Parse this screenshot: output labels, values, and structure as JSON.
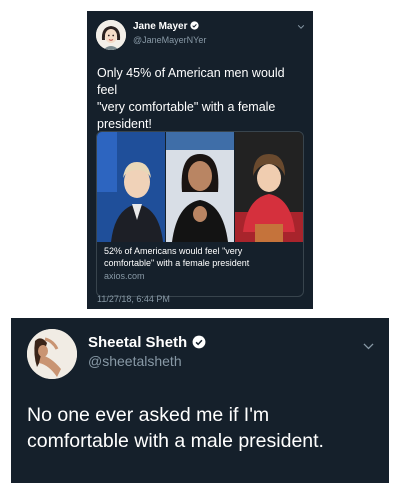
{
  "tweet1": {
    "display_name": "Jane Mayer",
    "handle": "@JaneMayerNYer",
    "text": "Only 45% of American men would feel\n\"very comfortable\" with a female\npresident!",
    "card": {
      "title": "52% of Americans would feel \"very\ncomfortable\" with a female president",
      "domain": "axios.com"
    },
    "timestamp": "11/27/18, 6:44 PM"
  },
  "tweet2": {
    "display_name": "Sheetal Sheth",
    "handle": "@sheetalsheth",
    "text": "No one ever asked me if I'm\ncomfortable with a male president."
  },
  "icons": {
    "verified": "verified-badge-icon",
    "more": "chevron-down-icon"
  },
  "colors": {
    "background": "#15202b",
    "text": "#ffffff",
    "secondary_text": "#8899a6",
    "verified_fill": "#ffffff"
  }
}
